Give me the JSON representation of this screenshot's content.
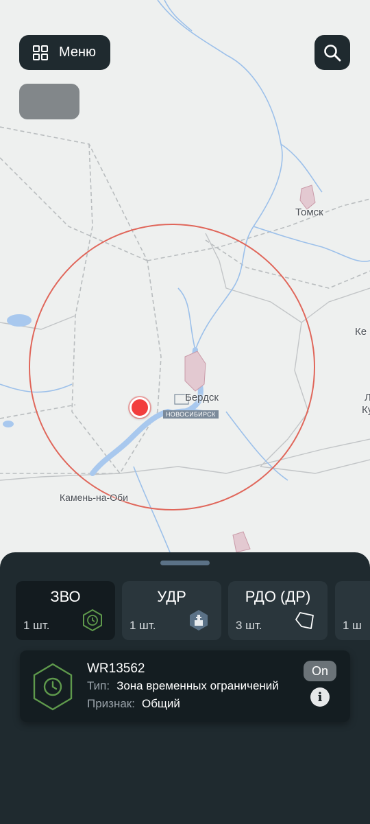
{
  "top_bar": {
    "menu_label": "Меню",
    "menu_icon": "grid-icon",
    "search_icon": "search-icon"
  },
  "map": {
    "labels": {
      "tomsk": "Томск",
      "berdsk": "Бердск",
      "novosibirsk": "НОВОСИБИРСК",
      "kamen": "Камень-на-Оби",
      "edge_1": "Ке",
      "edge_2": "Л",
      "edge_3": "Ку"
    },
    "colors": {
      "zone_circle": "#e0665a",
      "marker": "#f23d3d",
      "water": "#a8c8ee",
      "borders": "#b9bdbf"
    }
  },
  "sheet": {
    "categories": [
      {
        "name": "ЗВО",
        "count": "1 шт.",
        "icon": "clock-hex-icon",
        "active": true
      },
      {
        "name": "УДР",
        "count": "1 шт.",
        "icon": "tower-shield-icon",
        "active": false
      },
      {
        "name": "РДО (ДР)",
        "count": "3 шт.",
        "icon": "polygon-icon",
        "active": false
      },
      {
        "name": "",
        "count": "1 ш",
        "icon": "",
        "active": false
      }
    ],
    "zone": {
      "code": "WR13562",
      "type_label": "Тип:",
      "type_value": "Зона временных ограничений",
      "sign_label": "Признак:",
      "sign_value": "Общий",
      "toggle_label": "On",
      "info_label": "i",
      "icon": "clock-hex-icon",
      "icon_color": "#5f9a4c"
    }
  }
}
